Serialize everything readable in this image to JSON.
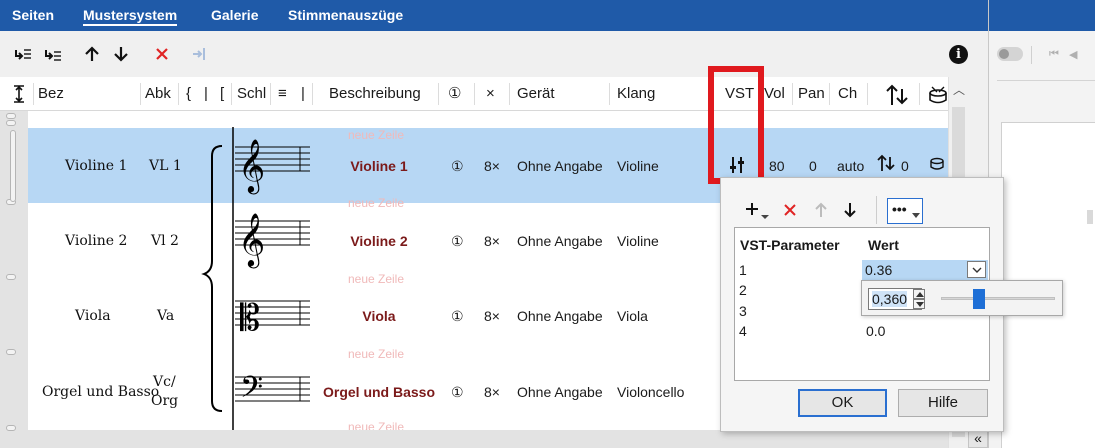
{
  "tabs": [
    {
      "label": "Seiten"
    },
    {
      "label": "Mustersystem"
    },
    {
      "label": "Galerie"
    },
    {
      "label": "Stimmenauszüge"
    }
  ],
  "columns": {
    "bez": "Bez",
    "abk": "Abk",
    "brace": "{",
    "bar1": "|",
    "bracket": "[",
    "schl": "Schl",
    "lines": "≡",
    "bar2": "|",
    "beschreibung": "Beschreibung",
    "transpose": "①",
    "times": "×",
    "geraet": "Gerät",
    "klang": "Klang",
    "vst": "VST",
    "vol": "Vol",
    "pan": "Pan",
    "ch": "Ch"
  },
  "new_row_label": "neue Zeile",
  "rows": [
    {
      "bez": "Violine 1",
      "abk": "VL 1",
      "beschreibung": "Violine 1",
      "transpose": "①",
      "times": "8×",
      "geraet": "Ohne Angabe",
      "klang": "Violine",
      "vol": "80",
      "pan": "0",
      "ch": "auto",
      "extra": "0",
      "selected": true
    },
    {
      "bez": "Violine 2",
      "abk": "Vl 2",
      "beschreibung": "Violine 2",
      "transpose": "①",
      "times": "8×",
      "geraet": "Ohne Angabe",
      "klang": "Violine"
    },
    {
      "bez": "Viola",
      "abk": "Va",
      "beschreibung": "Viola",
      "transpose": "①",
      "times": "8×",
      "geraet": "Ohne Angabe",
      "klang": "Viola"
    },
    {
      "bez": "Orgel und Basso",
      "abk_line1": "Vc/",
      "abk_line2": "Org",
      "beschreibung": "Orgel und Basso",
      "transpose": "①",
      "times": "8×",
      "geraet": "Ohne Angabe",
      "klang": "Violoncello"
    }
  ],
  "popup": {
    "col_param": "VST-Parameter",
    "col_value": "Wert",
    "params": [
      {
        "index": "1",
        "value": "0.36"
      },
      {
        "index": "2",
        "value": ""
      },
      {
        "index": "3",
        "value": ""
      },
      {
        "index": "4",
        "value": "0.0"
      }
    ],
    "spin_value": "0,360",
    "ok_label": "OK",
    "help_label": "Hilfe",
    "more_label": "•••"
  },
  "info_icon": "i",
  "collapse_label": "«",
  "colors": {
    "accent": "#1f5aa8",
    "selection": "#b7d7f4",
    "highlight": "#e0191e",
    "description": "#7b1a1a"
  }
}
